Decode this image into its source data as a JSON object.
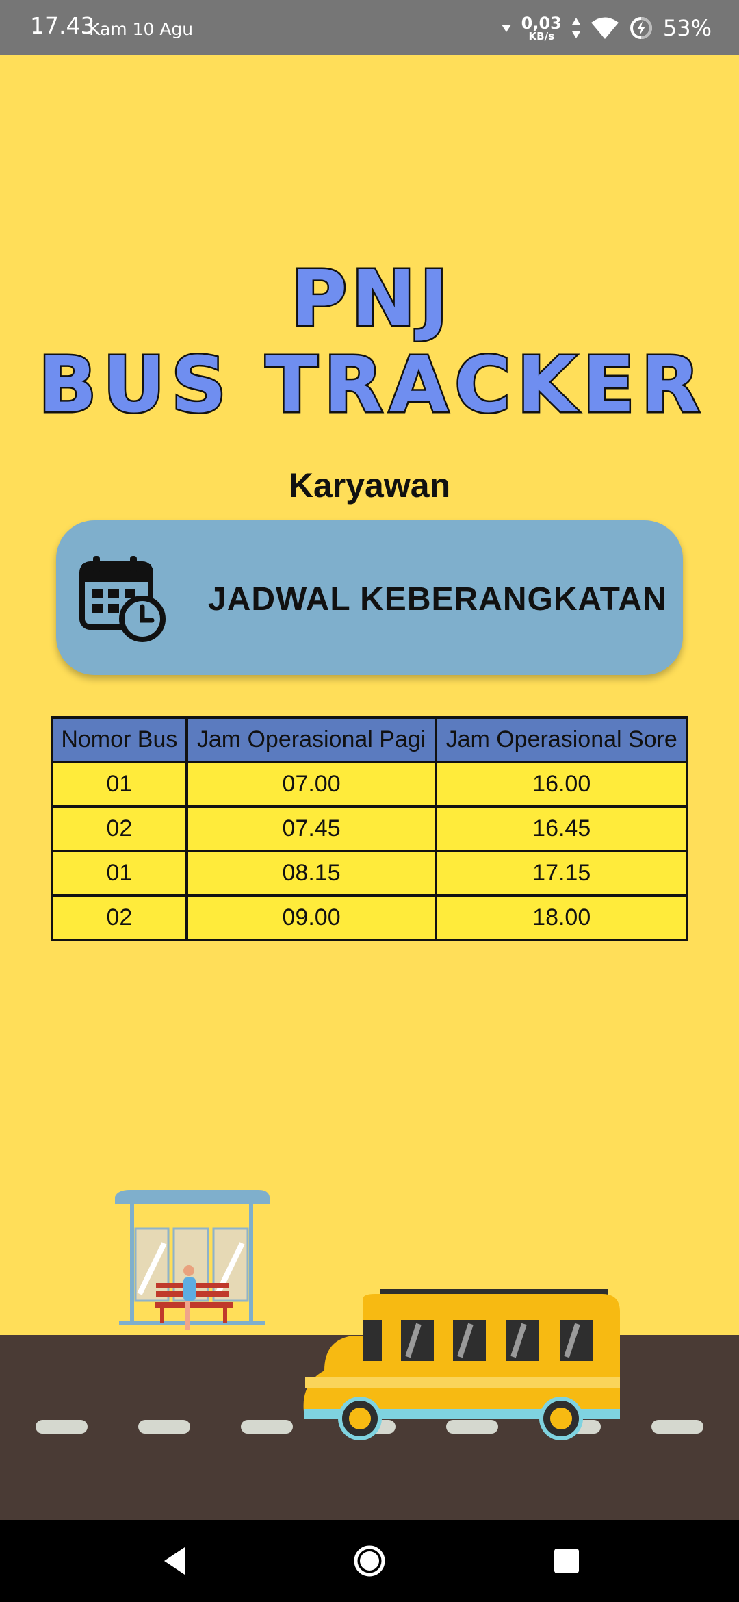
{
  "status_bar": {
    "time": "17.43",
    "date": "Kam 10 Agu",
    "net_speed": "0,03",
    "net_unit": "KB/s",
    "battery": "53%",
    "icons": [
      "wifi-signal-icon",
      "data-arrows-icon",
      "wifi-icon",
      "battery-charging-icon"
    ]
  },
  "header": {
    "title_line1": "PNJ",
    "title_line2": "BUS TRACKER",
    "subtitle": "Karyawan"
  },
  "schedule_button": {
    "label": "JADWAL KEBERANGKATAN",
    "icon": "calendar-clock-icon"
  },
  "table": {
    "headers": [
      "Nomor Bus",
      "Jam Operasional Pagi",
      "Jam Operasional Sore"
    ],
    "rows": [
      [
        "01",
        "07.00",
        "16.00"
      ],
      [
        "02",
        "07.45",
        "16.45"
      ],
      [
        "01",
        "08.15",
        "17.15"
      ],
      [
        "02",
        "09.00",
        "18.00"
      ]
    ]
  },
  "colors": {
    "background": "#FFDE59",
    "title_fill": "#6F8EF0",
    "button": "#7FAFCC",
    "table_header": "#5B7BBF",
    "table_cell": "#FFEB3B",
    "road": "#4A3B35",
    "bus": "#F7BA12"
  },
  "navigation": {
    "icons": [
      "back-icon",
      "home-icon",
      "recents-icon"
    ]
  }
}
